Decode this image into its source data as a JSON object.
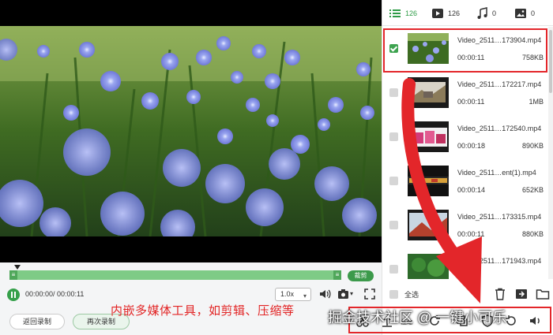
{
  "panel": {
    "tabs": [
      {
        "label": "126",
        "icon": "list-icon",
        "active": true
      },
      {
        "label": "126",
        "icon": "video-icon",
        "active": false
      },
      {
        "label": "0",
        "icon": "music-icon",
        "active": false
      },
      {
        "label": "0",
        "icon": "image-icon",
        "active": false
      }
    ],
    "files": [
      {
        "name": "Video_2511…173904.mp4",
        "duration": "00:00:11",
        "size": "758KB",
        "checked": true
      },
      {
        "name": "Video_2511…172217.mp4",
        "duration": "00:00:11",
        "size": "1MB",
        "checked": false
      },
      {
        "name": "Video_2511…172540.mp4",
        "duration": "00:00:18",
        "size": "890KB",
        "checked": false
      },
      {
        "name": "Video_2511…ent(1).mp4",
        "duration": "00:00:14",
        "size": "652KB",
        "checked": false
      },
      {
        "name": "Video_2511…173315.mp4",
        "duration": "00:00:11",
        "size": "880KB",
        "checked": false
      },
      {
        "name": "Video_2511…171943.mp4",
        "duration": "",
        "size": "",
        "checked": false
      }
    ],
    "select_all_label": "全选"
  },
  "player": {
    "clip_label": "裁剪",
    "time_readout": "00:00:00/ 00:00:11",
    "speed": "1.0x",
    "back_label": "返回录制",
    "again_label": "再次录制",
    "compress_label": "压缩"
  },
  "annotation": "内嵌多媒体工具，如剪辑、压缩等",
  "watermark": "掘金技术社区 @ 一键小可乐",
  "colors": {
    "accent": "#36a04a",
    "highlight": "#e3262a",
    "timeline": "#7ecb86"
  }
}
